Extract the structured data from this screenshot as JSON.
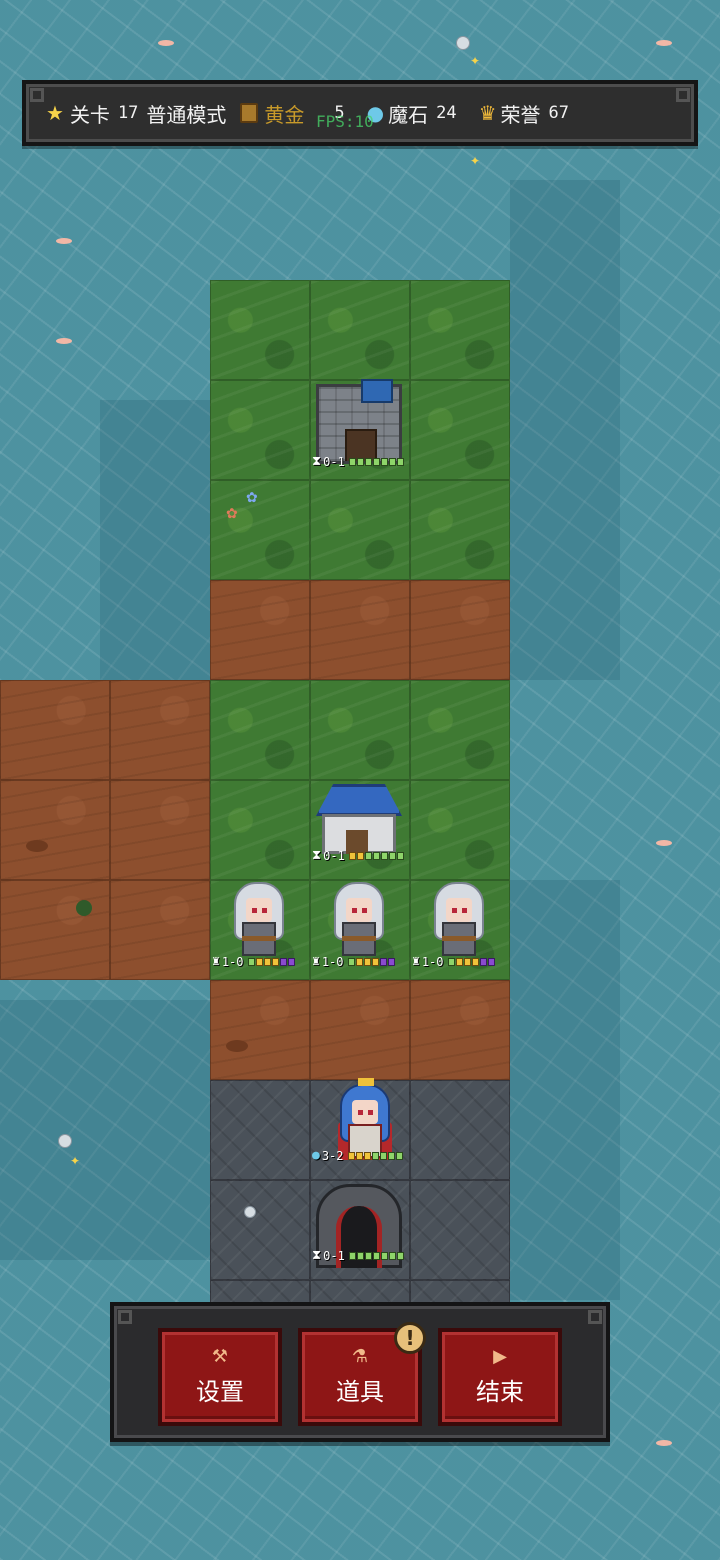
{
  "topbar": {
    "level_label": "关卡",
    "level_value": "17",
    "mode": "普通模式",
    "gold_label": "黄金",
    "gold_value": "5",
    "magic_stone_label": "魔石",
    "magic_stone_value": "24",
    "honor_label": "荣誉",
    "honor_value": "67",
    "fps_overlay": "FPS:10"
  },
  "icons": {
    "level": "star-icon",
    "gold": "gold-bar-icon",
    "magic_stone": "blue-orb-icon",
    "honor": "crown-icon"
  },
  "board": {
    "castle_hud": "0-1",
    "house_hud": "0-1",
    "unit_hud": "1-0",
    "queen_hud": "3-2",
    "gate_hud": "0-1"
  },
  "actions": {
    "settings_label": "设置",
    "items_label": "道具",
    "items_badge": "!",
    "end_label": "结束"
  },
  "colors": {
    "button_red": "#8e1616",
    "grass": "#3f7a33",
    "dirt": "#8d4f2e",
    "stone": "#4a5159",
    "water": "#5aa5b2"
  }
}
